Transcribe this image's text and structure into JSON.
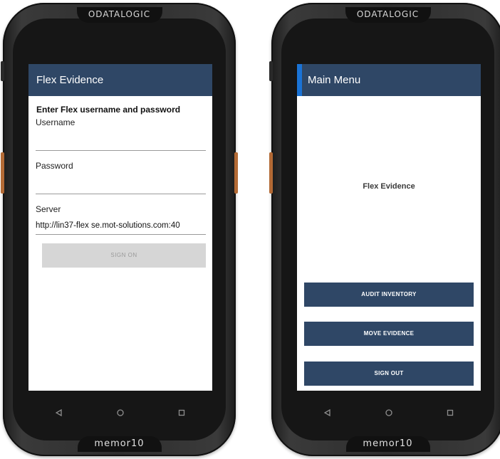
{
  "left_device": {
    "brand_top": "ODATALOGIC",
    "brand_bottom": "memor10",
    "app_title": "Flex Evidence",
    "heading": "Enter Flex username and password",
    "username_label": "Username",
    "username_value": "",
    "password_label": "Password",
    "password_value": "",
    "server_label": "Server",
    "server_value": "http://lin37-flex se.mot-solutions.com:40",
    "signon_label": "SIGN ON"
  },
  "right_device": {
    "brand_top": "ODATALOGIC",
    "brand_bottom": "memor10",
    "title": "Main Menu",
    "center_label": "Flex Evidence",
    "buttons": [
      "AUDIT INVENTORY",
      "MOVE EVIDENCE",
      "SIGN OUT"
    ]
  },
  "nav": {
    "back_icon": "back-triangle-icon",
    "home_icon": "home-circle-icon",
    "recents_icon": "recents-square-icon"
  },
  "colors": {
    "appbar": "#2f4766",
    "accent": "#1a73d6",
    "device_body": "#2e2e2e",
    "side_button": "#b36a35",
    "disabled_button": "#d6d6d6"
  }
}
